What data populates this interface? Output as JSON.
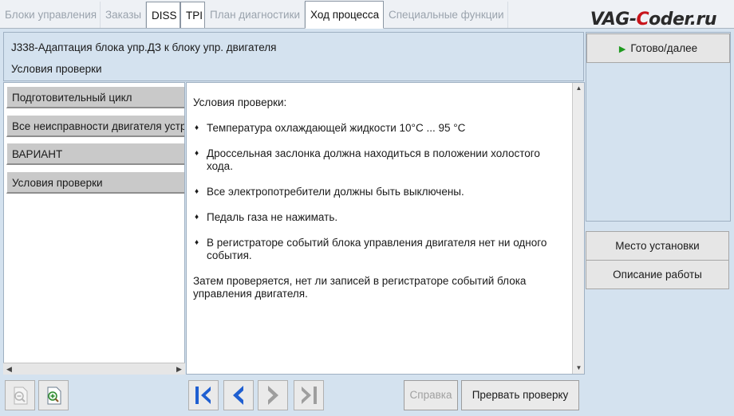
{
  "tabs": [
    {
      "label": "Блоки управления",
      "state": "disabled"
    },
    {
      "label": "Заказы",
      "state": "disabled"
    },
    {
      "label": "DISS",
      "state": "enabled"
    },
    {
      "label": "TPI",
      "state": "enabled"
    },
    {
      "label": "План диагностики",
      "state": "disabled"
    },
    {
      "label": "Ход процесса",
      "state": "active"
    },
    {
      "label": "Специальные функции",
      "state": "disabled"
    }
  ],
  "watermark": {
    "part1": "VAG-",
    "accent": "C",
    "part2": "oder.ru"
  },
  "header": {
    "title": "J338-Адаптация блока упр.ДЗ к блоку упр. двигателя",
    "subtitle": "Условия проверки"
  },
  "nav": {
    "items": [
      {
        "label": "Подготовительный цикл"
      },
      {
        "label": "Все неисправности двигателя устранены"
      },
      {
        "label": "ВАРИАНТ"
      },
      {
        "label": "Условия проверки"
      }
    ]
  },
  "content": {
    "heading": "Условия проверки:",
    "bullets": [
      "Температура охлаждающей жидкости 10°C ... 95 °C",
      "Дроссельная заслонка должна находиться в положении холостого хода.",
      "Все электропотребители должны быть выключены.",
      "Педаль газа не нажимать.",
      "В регистраторе событий блока управления двигателя нет ни одного события."
    ],
    "footer": "Затем проверяется, нет ли записей в регистраторе событий блока управления двигателя."
  },
  "right": {
    "ready_label": "Готово/далее",
    "location_label": "Место установки",
    "description_label": "Описание работы"
  },
  "toolbar": {
    "help_label": "Справка",
    "abort_label": "Прервать проверку"
  },
  "colors": {
    "nav_blue": "#1f5fd1",
    "disabled_gray": "#9e9e9e",
    "play_green": "#1e9a1e",
    "brand_red": "#c8141b"
  }
}
